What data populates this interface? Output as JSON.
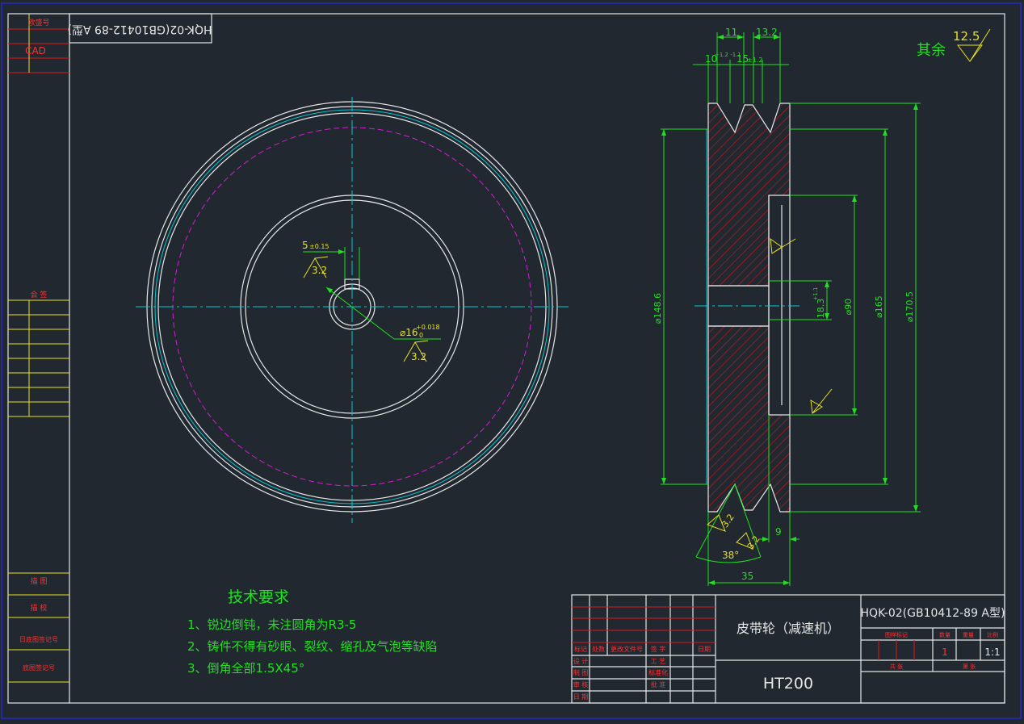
{
  "drawing": {
    "title_box": "HQK-02(GB10412-89 A型)",
    "surface_note": "其余",
    "surface_value": "12.5"
  },
  "left_strip": {
    "labels": [
      "欧盛号",
      "CAD",
      "会 签",
      "描 图",
      "描 校",
      "日底图签记号",
      "底图签记号"
    ]
  },
  "front_view": {
    "keyway_width": "5",
    "keyway_tol": "±0.15",
    "bore_dia": "⌀16",
    "bore_tol_upper": "+0.018",
    "bore_tol_lower": "0",
    "roughness": "3.2"
  },
  "section_view": {
    "dims": {
      "top_11": "11",
      "top_13_2": "13.2",
      "groove_10": "10",
      "groove_10_tol": "+1.2 -1.1",
      "pitch_15": "15",
      "pitch_15_tol": "±1.2",
      "dia_148_6": "⌀148.6",
      "dia_18_3": "18.3",
      "dia_18_3_tol": "+1.1",
      "dia_90": "⌀90",
      "dia_165": "⌀165",
      "dia_170_5": "⌀170.5",
      "width_35": "35",
      "hub_9": "9",
      "angle_38": "38°",
      "rough_32": "3.2"
    }
  },
  "tech_requirements": {
    "heading": "技术要求",
    "items": [
      "1、锐边倒钝，未注圆角为R3-5",
      "2、铸件不得有砂眼、裂纹、缩孔及气泡等缺陷",
      "3、倒角全部1.5X45°"
    ]
  },
  "title_block": {
    "part_name": "皮带轮（减速机）",
    "material": "HT200",
    "drawing_no": "HQK-02(GB10412-89 A型)",
    "quantity": "1",
    "scale": "1:1",
    "header_cols": [
      "标记",
      "处数",
      "更改文件号",
      "签 字",
      "日期"
    ],
    "rows_left": [
      "设 计",
      "制 图",
      "审 核",
      "日 期"
    ],
    "rows_mid": [
      "工 艺",
      "标准化",
      "批 准"
    ],
    "right_header": [
      "图样标记",
      "数量",
      "重量",
      "比例"
    ],
    "right_footer": [
      "共  张",
      "第  张"
    ]
  },
  "colors": {
    "background": "#212830",
    "outline": "#e6e6e6",
    "center": "#00c8d2",
    "pitch": "#d020d0",
    "dimension": "#20e020",
    "hatch": "#e01818",
    "roughness": "#e8e020",
    "frame": "#2828c8"
  }
}
